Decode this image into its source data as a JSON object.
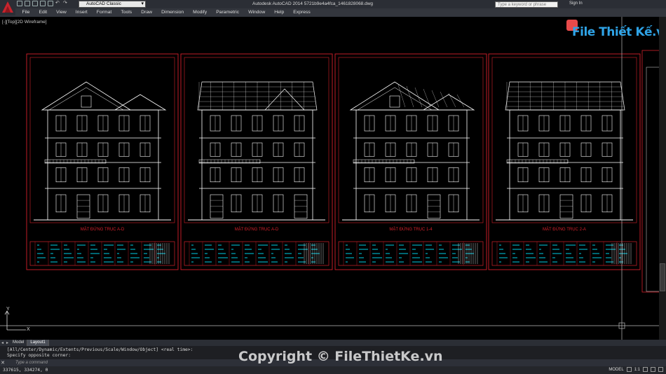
{
  "app": {
    "title": "Autodesk AutoCAD 2014    5721b9e4a4fca_1461828068.dwg",
    "workspace": "AutoCAD Classic",
    "search_placeholder": "Type a keyword or phrase",
    "sign_in": "Sign In"
  },
  "menu": [
    "File",
    "Edit",
    "View",
    "Insert",
    "Format",
    "Tools",
    "Draw",
    "Dimension",
    "Modify",
    "Parametric",
    "Window",
    "Help",
    "Express"
  ],
  "viewport": {
    "label": "[-][Top][2D Wireframe]"
  },
  "sheets": [
    {
      "caption": "MẶT ĐỨNG TRỤC A-D"
    },
    {
      "caption": "MẶT ĐỨNG TRỤC A-D"
    },
    {
      "caption": "MẶT ĐỨNG TRỤC 1-4"
    },
    {
      "caption": "MẶT ĐỨNG TRỤC 2-A"
    }
  ],
  "watermark": "File Thiết Kế.vn",
  "layout_tabs": [
    "Model",
    "Layout1"
  ],
  "command": {
    "history_line1": "[All/Center/Dynamic/Extents/Previous/Scale/Window/Object] <real time>:",
    "history_line2": "Specify opposite corner:",
    "prompt": "Type a command"
  },
  "copyright": "Copyright © FileThietKe.vn",
  "status": {
    "coords": "337615, 334274, 0",
    "model": "MODEL",
    "scale": "1:1"
  },
  "colors": {
    "drawing_lines": "#ffffff",
    "frame": "#d4212b",
    "annotation": "#00e5ff",
    "background": "#000000"
  }
}
